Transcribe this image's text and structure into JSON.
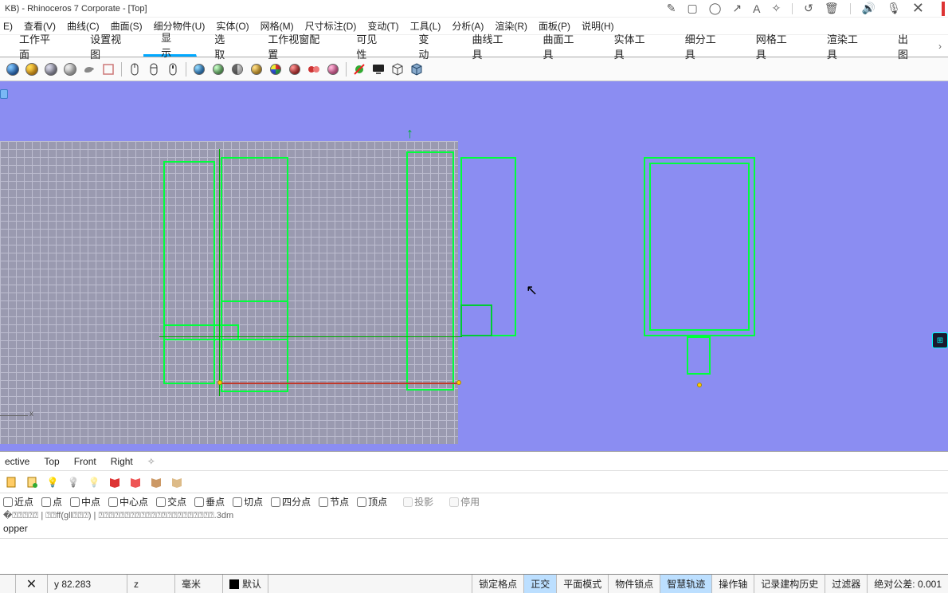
{
  "title": "KB) - Rhinoceros 7 Corporate - [Top]",
  "menus": [
    "E)",
    "查看(V)",
    "曲线(C)",
    "曲面(S)",
    "细分物件(U)",
    "实体(O)",
    "网格(M)",
    "尺寸标注(D)",
    "变动(T)",
    "工具(L)",
    "分析(A)",
    "渲染(R)",
    "面板(P)",
    "说明(H)"
  ],
  "tabs": [
    "工作平面",
    "设置视图",
    "显示",
    "选取",
    "工作视窗配置",
    "可见性",
    "变动",
    "曲线工具",
    "曲面工具",
    "实体工具",
    "细分工具",
    "网格工具",
    "渲染工具",
    "出图"
  ],
  "active_tab": 2,
  "viewport_tabs": [
    "ective",
    "Top",
    "Front",
    "Right"
  ],
  "osnaps": [
    "近点",
    "点",
    "中点",
    "中心点",
    "交点",
    "垂点",
    "切点",
    "四分点",
    "节点",
    "顶点"
  ],
  "osnap_special": [
    {
      "label": "投影",
      "checked": false
    },
    {
      "label": "停用",
      "checked": false
    }
  ],
  "garble_text": "�⍰⍰⍰⍰⍰ | ⍰⍰ff(gll⍰⍰⍰) | ⍰⍰⍰⍰⍰⍰⍰⍰⍰⍰⍰⍰⍰⍰⍰⍰⍰⍰⍰⍰⍰⍰.3dm",
  "hopper": "opper",
  "status": {
    "y": "y 82.283",
    "z": "z",
    "unit": "毫米",
    "layer": "默认",
    "items": [
      "锁定格点",
      "正交",
      "平面模式",
      "物件锁点",
      "智慧轨迹",
      "操作轴",
      "记录建构历史",
      "过滤器"
    ],
    "highlights": [
      1,
      4
    ],
    "tol": "绝对公差: 0.001"
  },
  "title_icons": [
    "pencil",
    "square",
    "circle",
    "arrow-tr",
    "letter-a",
    "wand",
    "undo",
    "trash",
    "speaker",
    "mic",
    "x"
  ]
}
